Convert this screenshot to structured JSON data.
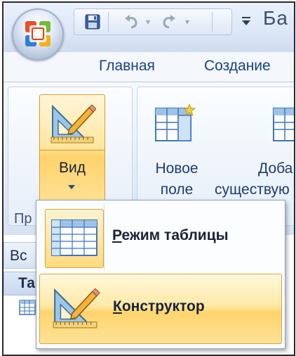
{
  "app": {
    "title_fragment": "Ба"
  },
  "quick_access": {
    "items": [
      "save-icon",
      "undo-icon",
      "redo-icon",
      "customize-dropdown-icon"
    ]
  },
  "tabs": [
    {
      "label": "Главная"
    },
    {
      "label": "Создание"
    }
  ],
  "ribbon": {
    "view_group": {
      "button_label": "Вид",
      "caption_fragment": "Пр"
    },
    "fields_group": {
      "new_field": {
        "line1": "Новое",
        "line2": "поле"
      },
      "add_existing": {
        "line1": "Доба",
        "line2": "существую"
      }
    }
  },
  "nav_pane": {
    "header_fragment": "Вс",
    "sub_fragment": "Та"
  },
  "view_menu": {
    "items": [
      {
        "accel": "Р",
        "rest": "ежим таблицы",
        "icon": "datasheet-view-icon"
      },
      {
        "accel": "К",
        "rest": "онструктор",
        "icon": "design-view-icon"
      }
    ]
  },
  "colors": {
    "ribbon_text": "#15428b",
    "highlight_gold": "#ffd46d",
    "highlight_border": "#d9a63b"
  }
}
